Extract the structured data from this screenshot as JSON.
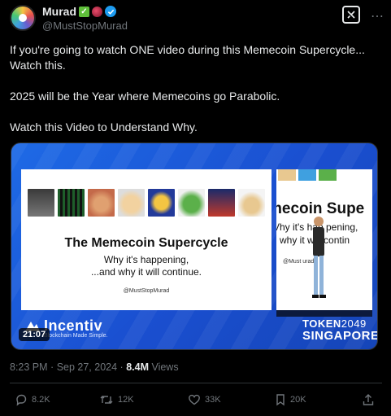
{
  "author": {
    "display_name": "Murad",
    "handle": "@MustStopMurad",
    "checkmark_emoji": "✓"
  },
  "tweet": {
    "paragraphs": [
      "If you're going to watch ONE video during this Memecoin Supercycle... Watch this.",
      "2025 will be the Year where Memecoins go Parabolic.",
      "Watch this Video to Understand Why."
    ]
  },
  "video": {
    "duration": "21:07",
    "slide_title": "The Memecoin Supercycle",
    "slide_sub1": "Why it's happening,",
    "slide_sub2": "...and why it will continue.",
    "slide_handle": "@MustStopMurad",
    "side_text1": "mecoin Supe",
    "side_text2": "Vhy it's hap  pening,",
    "side_text3": "d why it  will contin",
    "side_text4": "@Must  urad",
    "brand_name": "Incentiv",
    "brand_tagline": "Blockchain Made Simple.",
    "event_name": "TOKEN",
    "event_year": "2049",
    "event_city": "SINGAPORE"
  },
  "meta": {
    "time": "8:23 PM",
    "date": "Sep 27, 2024",
    "views_count": "8.4M",
    "views_label": "Views"
  },
  "actions": {
    "replies": "8.2K",
    "reposts": "12K",
    "likes": "33K",
    "bookmarks": "20K"
  },
  "colors": {
    "accent": "#1d9bf0",
    "muted": "#71767b",
    "text": "#e7e9ea",
    "video_bg": "#1a4fd0"
  }
}
